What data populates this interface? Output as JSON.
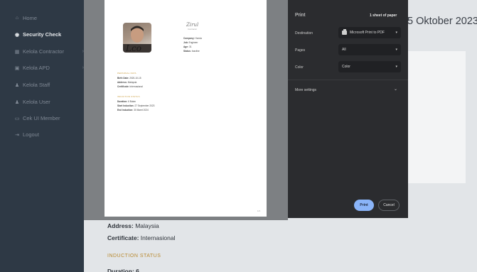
{
  "sidebar": {
    "items": [
      {
        "label": "Home",
        "icon": "home-icon",
        "glyph": "⌂"
      },
      {
        "label": "Security Check",
        "icon": "eye-icon",
        "glyph": "◉"
      },
      {
        "label": "Kelola Contractor",
        "icon": "grid-icon",
        "glyph": "▦"
      },
      {
        "label": "Kelola APD",
        "icon": "box-icon",
        "glyph": "▣"
      },
      {
        "label": "Kelola Staff",
        "icon": "user-icon",
        "glyph": "♟"
      },
      {
        "label": "Kelola User",
        "icon": "users-icon",
        "glyph": "♟"
      },
      {
        "label": "Cek UI Member",
        "icon": "card-icon",
        "glyph": "▭"
      },
      {
        "label": "Logout",
        "icon": "logout-icon",
        "glyph": "⇥"
      }
    ]
  },
  "main": {
    "date_partial": "5 Oktober 2023",
    "address_label": "Address:",
    "address_value": "Malaysia",
    "certificate_label": "Certificate:",
    "certificate_value": "Internasional",
    "induction_status": "INDUCTION STATUS"
  },
  "preview": {
    "signature": "Zirul",
    "signature_sub": "Contractor",
    "company": {
      "label": "Company:",
      "value": "Honda"
    },
    "job": {
      "label": "Job:",
      "value": "Engineer"
    },
    "age": {
      "label": "Age:",
      "value": "31"
    },
    "status": {
      "label": "Status:",
      "value": "Inactive"
    },
    "personal_data": "PERSONAL DATA",
    "birth_date": {
      "label": "Birth Date:",
      "value": "2020-10-15"
    },
    "address": {
      "label": "Address:",
      "value": "Malaysia"
    },
    "certificate": {
      "label": "Certificate:",
      "value": "Internasional"
    },
    "induction_status": "INDUCTION STATUS",
    "duration": {
      "label": "Duration:",
      "value": "6 Bulan"
    },
    "start_induction": {
      "label": "Start Induction:",
      "value": "27 September 2023"
    },
    "end_induction": {
      "label": "End Induction:",
      "value": "30 Maret 2024"
    },
    "page_number": "1/1"
  },
  "print_dialog": {
    "title": "Print",
    "sheets": "1 sheet of paper",
    "destination": {
      "label": "Destination",
      "value": "Microsoft Print to PDF"
    },
    "pages": {
      "label": "Pages",
      "value": "All"
    },
    "color": {
      "label": "Color",
      "value": "Color"
    },
    "more_settings": "More settings",
    "print_button": "Print",
    "cancel_button": "Cancel",
    "accent_color": "#8ab4f8"
  }
}
